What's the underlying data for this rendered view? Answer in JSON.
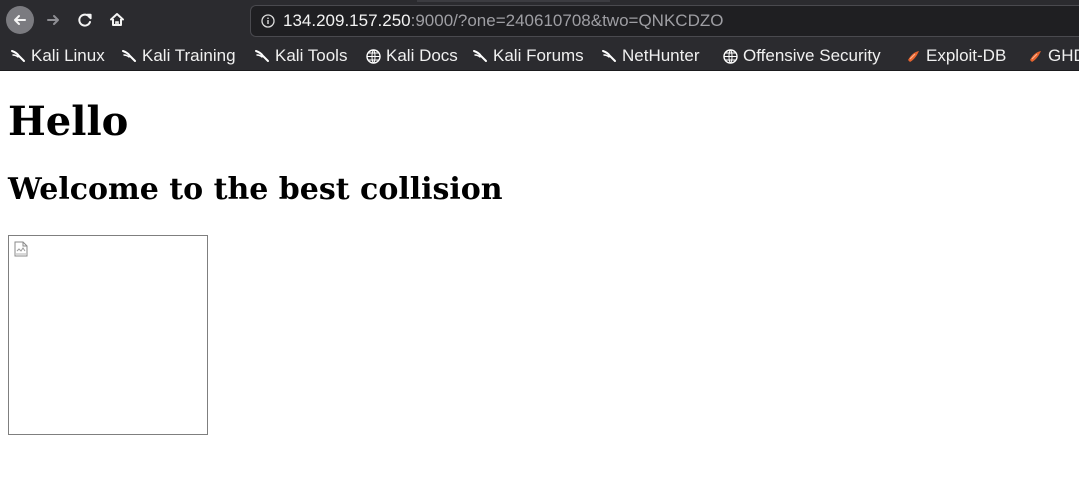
{
  "browser": {
    "address": {
      "host": "134.209.157.250",
      "rest": ":9000/?one=240610708&two=QNKCDZO"
    },
    "bookmarks": [
      {
        "label": "Kali Linux",
        "icon": "kali-dragon-icon"
      },
      {
        "label": "Kali Training",
        "icon": "kali-dragon-icon"
      },
      {
        "label": "Kali Tools",
        "icon": "kali-dragon-icon"
      },
      {
        "label": "Kali Docs",
        "icon": "globe-icon"
      },
      {
        "label": "Kali Forums",
        "icon": "kali-dragon-icon"
      },
      {
        "label": "NetHunter",
        "icon": "kali-dragon-icon"
      },
      {
        "label": "Offensive Security",
        "icon": "globe-icon"
      },
      {
        "label": "Exploit-DB",
        "icon": "exploit-db-icon"
      },
      {
        "label": "GHD",
        "icon": "exploit-db-icon"
      }
    ]
  },
  "page": {
    "title": "Hello",
    "subtitle": "Welcome to the best collision"
  },
  "colors": {
    "chrome_dark": "#2b2b2f",
    "url_field": "#1f1f22",
    "text_light": "#f0f0f0",
    "url_muted": "#9e9ea3",
    "exploit_db_orange": "#e7642f"
  }
}
